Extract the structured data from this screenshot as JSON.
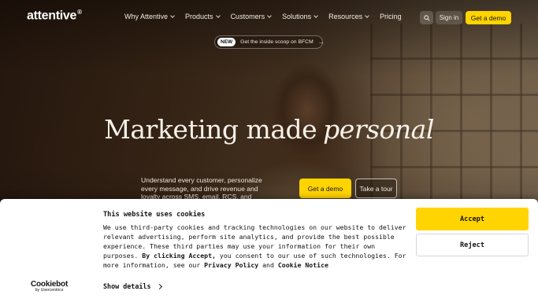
{
  "nav": {
    "logo": "attentive",
    "logo_mark": "®",
    "links": [
      {
        "label": "Why Attentive",
        "has_menu": true
      },
      {
        "label": "Products",
        "has_menu": true
      },
      {
        "label": "Customers",
        "has_menu": true
      },
      {
        "label": "Solutions",
        "has_menu": true
      },
      {
        "label": "Resources",
        "has_menu": true
      },
      {
        "label": "Pricing",
        "has_menu": false
      }
    ],
    "search_icon": "search-icon",
    "signin_label": "Sign in",
    "demo_label": "Get a demo"
  },
  "announcement": {
    "badge": "NEW",
    "text": "Get the inside scoop on BFCM",
    "arrow": "→"
  },
  "hero": {
    "headline_plain": "Marketing made",
    "headline_italic": "personal",
    "subcopy": "Understand every customer, personalize every message, and drive revenue and loyalty across SMS, email, RCS, and push",
    "demo_label": "Get a demo",
    "tour_label": "Take a tour"
  },
  "cookie": {
    "title": "This website uses cookies",
    "body_1": "We use third-party cookies and tracking technologies on our website to deliver relevant advertising, perform site analytics, and provide the best possible experience. These third parties may use your information for their own purposes. ",
    "body_bold_1": "By clicking Accept,",
    "body_2": " you consent to our use of such technologies. For more information, see our ",
    "privacy_link": "Privacy Policy",
    "body_3": " and ",
    "cookie_link": "Cookie Notice",
    "show_details": "Show details",
    "accept_label": "Accept",
    "reject_label": "Reject",
    "brand_name": "Cookiebot",
    "brand_by": "by Usercentrics"
  },
  "colors": {
    "accent": "#ffd400",
    "banner_bg": "#ffffff",
    "hero_text": "#f7f1e8"
  }
}
